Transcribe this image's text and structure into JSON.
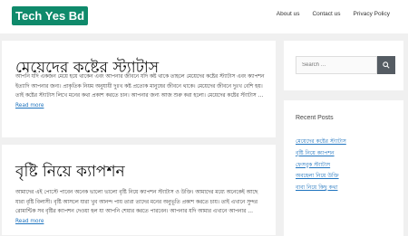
{
  "site": {
    "logo_text": "Tech Yes Bd"
  },
  "nav": {
    "items": [
      "About us",
      "Contact us",
      "Privacy Policy"
    ]
  },
  "posts": [
    {
      "title": "মেয়েদের কষ্টের স্ট্যাটাস",
      "excerpt": "আপনি যদি একজন মেয়ে হয়ে থাকেন এবং আপনার জীবনে যদি কষ্ট থাকে তাহলে মেয়েদের কষ্টের স্ট্যাটাস এবং ক্যাপশন ইত্যাদি আপনার জন্য। প্রাকৃতিক নিয়ম অনুযায়ী দুঃখ কষ্ট প্রত্যেক মানুষের জীবনে থাকে। মেয়েদের জীবনে দুঃখ বেশি হয়। তাই কষ্টের স্ট্যাটাস লিখে মনের কথা প্রকাশ করতে চান। আপনার জন্য আজ শুরু করা হলো। মেয়েদের কষ্টের স্ট্যাটাস …",
      "read_more": "Read more"
    },
    {
      "title": "বৃষ্টি নিয়ে ক্যাপশন",
      "excerpt": "আমাদের এই পোস্টে পাবেন অনেক ভালো ভালো বৃষ্টি নিয়ে ক্যাপশন স্ট্যাটাস ও উক্তি। আমাদের মধ্যে অনেকেই আছে যারা বৃষ্টি বিলাসী। বৃষ্টি আসলে যারা খুব আনন্দ পায় তারা তাদের মনের অনুভূতি প্রকাশ করতে চায়। তাই এখানে সুন্দর রোমান্টিক সব বৃষ্টির ক্যাপশন দেওয়া হল যা আপনি শেয়ার করতে পারবেন। আপনার যদি আমার এখানে আপনার …",
      "read_more": "Read more"
    }
  ],
  "sidebar": {
    "search": {
      "placeholder": "Search …"
    },
    "recent_posts": {
      "title": "Recent Posts",
      "items": [
        "মেয়েদের কষ্টের স্ট্যাটাস",
        "বৃষ্টি নিয়ে ক্যাপশন",
        "ফেসবুক স্ট্যাটাস",
        "অবহেলা নিয়ে উক্তি",
        "বাবা নিয়ে কিছু কথা"
      ]
    }
  },
  "colors": {
    "brand": "#0f8a6b",
    "link": "#1e73be",
    "search_button": "#555c63"
  }
}
